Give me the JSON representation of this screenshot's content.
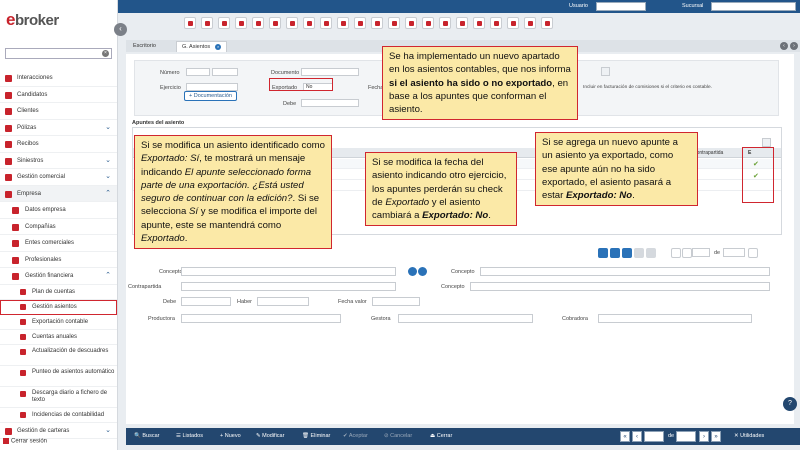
{
  "topbar": {
    "usuario_label": "Usuario",
    "sucursal_label": "Sucursal"
  },
  "sidebar": {
    "logo": "ebroker",
    "search_placeholder": "",
    "items": [
      {
        "label": "Interacciones",
        "level": 0,
        "icon": "handshake-icon"
      },
      {
        "label": "Candidatos",
        "level": 0,
        "icon": "person-add-icon"
      },
      {
        "label": "Clientes",
        "level": 0,
        "icon": "person-icon"
      },
      {
        "label": "Pólizas",
        "level": 0,
        "icon": "document-icon",
        "expandable": true
      },
      {
        "label": "Recibos",
        "level": 0,
        "icon": "receipt-icon"
      },
      {
        "label": "Siniestros",
        "level": 0,
        "icon": "fire-icon",
        "expandable": true
      },
      {
        "label": "Gestión comercial",
        "level": 0,
        "icon": "chart-icon",
        "expandable": true
      },
      {
        "label": "Empresa",
        "level": 0,
        "icon": "building-icon",
        "expandable": true,
        "expanded": true
      },
      {
        "label": "Datos empresa",
        "level": 1,
        "icon": "info-icon"
      },
      {
        "label": "Compañías",
        "level": 1,
        "icon": "companies-icon"
      },
      {
        "label": "Entes comerciales",
        "level": 1,
        "icon": "people-icon"
      },
      {
        "label": "Profesionales",
        "level": 1,
        "icon": "professional-icon"
      },
      {
        "label": "Gestión financiera",
        "level": 1,
        "icon": "finance-icon",
        "expandable": true,
        "expanded": true
      },
      {
        "label": "Plan de cuentas",
        "level": 2,
        "icon": "chart-line-icon"
      },
      {
        "label": "Gestión asientos",
        "level": 2,
        "icon": "gears-icon",
        "highlighted": true
      },
      {
        "label": "Exportación contable",
        "level": 2,
        "icon": "export-icon"
      },
      {
        "label": "Cuentas anuales",
        "level": 2,
        "icon": "calendar-icon"
      },
      {
        "label": "Actualización de descuadres",
        "level": 2,
        "icon": "refresh-icon",
        "tall": true
      },
      {
        "label": "Punteo de asientos automático",
        "level": 2,
        "icon": "dot-icon",
        "tall": true
      },
      {
        "label": "Descarga diario a fichero de texto",
        "level": 2,
        "icon": "download-icon",
        "tall": true
      },
      {
        "label": "Incidencias de contabilidad",
        "level": 2,
        "icon": "warning-icon"
      },
      {
        "label": "Gestión de carteras",
        "level": 0,
        "icon": "wallet-icon",
        "expandable": true
      }
    ],
    "close_session": "Cerrar sesión"
  },
  "tabs": [
    {
      "label": "Escritorio",
      "active": false
    },
    {
      "label": "G. Asientos",
      "active": true
    }
  ],
  "form": {
    "numero_label": "Número",
    "ejercicio_label": "Ejercicio",
    "documento_label": "Documento",
    "exportado_label": "Exportado",
    "exportado_value": "No",
    "debe_label": "Debe",
    "doc_button": "+ Documentación",
    "fecha_label": "Fecha",
    "note": "Incluir en facturación de comisiones si el criterio es contable."
  },
  "apuntes": {
    "title": "Apuntes del asiento",
    "col_contrapartida": "Contrapartida",
    "col_e": "E"
  },
  "detail": {
    "concepto_label": "Concepto",
    "contrapartida_label": "Contrapartida",
    "concepto2_label": "Concepto",
    "debe_label": "Debe",
    "haber_label": "Haber",
    "fecha_valor_label": "Fecha valor",
    "productora_label": "Productora",
    "gestora_label": "Gestora",
    "cobradora_label": "Cobradora",
    "de_label": "de"
  },
  "callouts": {
    "top": [
      {
        "t": "Se ha implementado un nuevo apartado en los asientos contables, que nos informa "
      },
      {
        "t": "si el asiento ha sido o no exportado",
        "b": true
      },
      {
        "t": ", en base a los apuntes que conforman el asiento."
      }
    ],
    "left": [
      {
        "t": "Si se modifica un asiento identificado como "
      },
      {
        "t": "Exportado: Sí",
        "i": true
      },
      {
        "t": ", te mostrará un mensaje indicando "
      },
      {
        "t": "El apunte seleccionado forma parte de una exportación. ¿Está usted seguro de continuar con la edición?",
        "i": true
      },
      {
        "t": ". Si se selecciona "
      },
      {
        "t": "Sí",
        "i": true
      },
      {
        "t": " y se modifica el importe del apunte, este se mantendrá como "
      },
      {
        "t": "Exportado",
        "i": true
      },
      {
        "t": "."
      }
    ],
    "middle": [
      {
        "t": "Si se modifica la fecha del asiento indicando otro ejercicio, los apuntes perderán su check de "
      },
      {
        "t": "Exportado",
        "i": true
      },
      {
        "t": " y el asiento cambiará a "
      },
      {
        "t": "Exportado: No",
        "b": true,
        "i": true
      },
      {
        "t": "."
      }
    ],
    "right": [
      {
        "t": "Si se agrega un nuevo apunte a un asiento ya exportado, como ese apunte aún no ha sido exportado, el asiento pasará a estar "
      },
      {
        "t": "Exportado: No",
        "b": true,
        "i": true
      },
      {
        "t": "."
      }
    ]
  },
  "bottombar": {
    "buscar": "Buscar",
    "listados": "Listados",
    "nuevo": "Nuevo",
    "modificar": "Modificar",
    "eliminar": "Eliminar",
    "aceptar": "Aceptar",
    "cancelar": "Cancelar",
    "cerrar": "Cerrar",
    "de": "de",
    "utilidades": "Utilidades"
  },
  "colors": {
    "brand_red": "#c8232c",
    "nav_blue": "#23476f",
    "callout_bg": "#fbe9a7",
    "callout_border": "#d0262f",
    "check_green": "#6aa136"
  }
}
